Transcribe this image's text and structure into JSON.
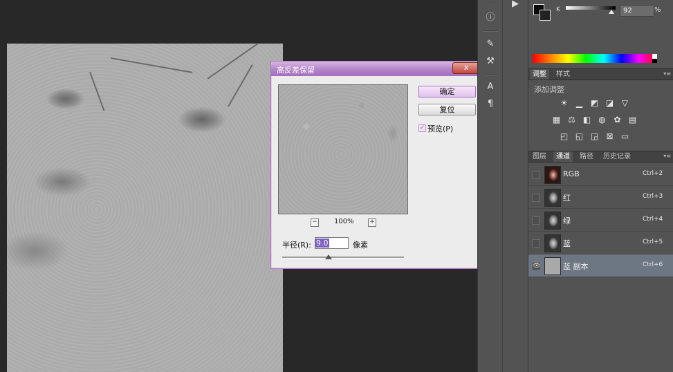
{
  "dialog": {
    "title": "高反差保留",
    "close_label": "x",
    "ok_label": "确定",
    "reset_label": "复位",
    "preview_label": "预览(P)",
    "preview_checked": true,
    "zoom_out": "−",
    "zoom_in": "+",
    "zoom_level": "100%",
    "radius_label": "半径(R):",
    "radius_value": "9.0",
    "radius_unit": "像素",
    "radius_slider_fraction": 0.38
  },
  "color_panel": {
    "channel_label": "K",
    "value": "92",
    "unit": "%",
    "foreground": "#0a0a0a",
    "background": "#222222"
  },
  "adjustments_panel": {
    "tabs": [
      "调整",
      "样式"
    ],
    "active_tab": "调整",
    "title": "添加调整",
    "icons_row1": [
      "brightness-icon",
      "levels-icon",
      "curves-icon",
      "exposure-icon",
      "vibrance-icon"
    ],
    "icons_row2": [
      "hue-saturation-icon",
      "color-balance-icon",
      "black-white-icon",
      "photo-filter-icon",
      "channel-mixer-icon",
      "color-lookup-icon"
    ],
    "icons_row3": [
      "invert-icon",
      "posterize-icon",
      "threshold-icon",
      "selective-color-icon",
      "gradient-map-icon"
    ]
  },
  "channels_panel": {
    "tabs": [
      "图层",
      "通道",
      "路径",
      "历史记录"
    ],
    "active_tab": "通道",
    "rows": [
      {
        "name": "RGB",
        "shortcut": "Ctrl+2"
      },
      {
        "name": "红",
        "shortcut": "Ctrl+3"
      },
      {
        "name": "绿",
        "shortcut": "Ctrl+4"
      },
      {
        "name": "蓝",
        "shortcut": "Ctrl+5"
      },
      {
        "name": "蓝 副本",
        "shortcut": "Ctrl+6"
      }
    ]
  }
}
